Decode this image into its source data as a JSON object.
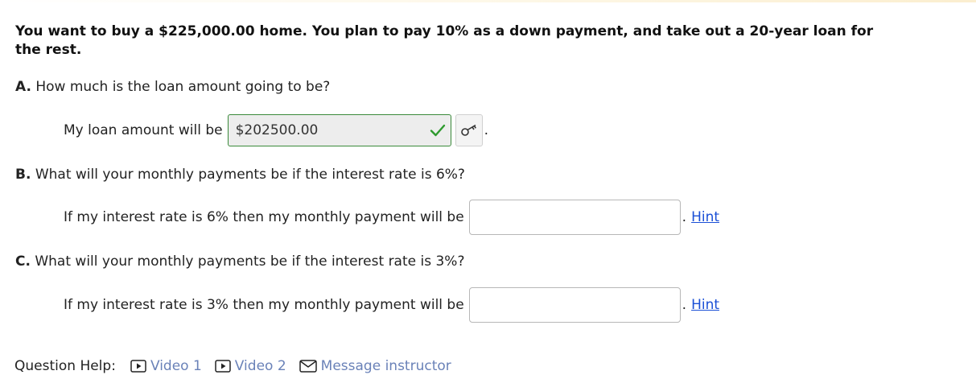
{
  "problem": {
    "statement": "You want to buy a $225,000.00 home. You plan to pay 10% as a down payment, and take out a 20-year loan for the rest."
  },
  "parts": [
    {
      "letter": "A.",
      "question": "How much is the loan amount going to be?",
      "answer_label": "My loan amount will be",
      "answer_value": "$202500.00",
      "status": "correct",
      "trailing": "."
    },
    {
      "letter": "B.",
      "question": "What will your monthly payments be if the interest rate is 6%?",
      "answer_label": "If my interest rate is 6% then my monthly payment will be",
      "answer_value": "",
      "trailing": ".",
      "hint_label": "Hint"
    },
    {
      "letter": "C.",
      "question": "What will your monthly payments be if the interest rate is 3%?",
      "answer_label": "If my interest rate is 3% then my monthly payment will be",
      "answer_value": "",
      "trailing": ".",
      "hint_label": "Hint"
    }
  ],
  "help": {
    "label": "Question Help:",
    "links": [
      {
        "label": "Video 1",
        "icon": "play-icon"
      },
      {
        "label": "Video 2",
        "icon": "play-icon"
      },
      {
        "label": "Message instructor",
        "icon": "envelope-icon"
      }
    ]
  },
  "colors": {
    "correct": "#2e9a2e",
    "link": "#1a4fd6",
    "help_link": "#6a82b8"
  }
}
